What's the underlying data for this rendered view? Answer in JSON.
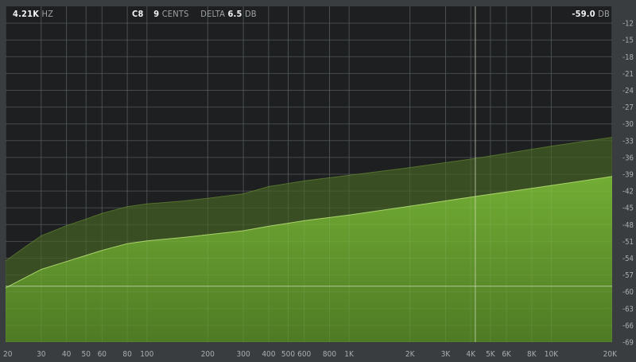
{
  "readout": {
    "frequency": {
      "value": "4.21K",
      "unit": "HZ"
    },
    "note": "C8",
    "cents": {
      "value": "9",
      "unit": "CENTS"
    },
    "delta": {
      "label": "DELTA",
      "value": "6.5",
      "unit": "DB"
    },
    "level": {
      "value": "-59.0",
      "unit": "DB"
    }
  },
  "cursor": {
    "frequency_hz": 4210,
    "level_db": -59.0
  },
  "chart_data": {
    "type": "area",
    "x_scale": "log",
    "xlim": [
      20,
      20000
    ],
    "ylim": [
      -69,
      -9
    ],
    "x_ticks": [
      {
        "label": "20",
        "hz": 20
      },
      {
        "label": "30",
        "hz": 30
      },
      {
        "label": "40",
        "hz": 40
      },
      {
        "label": "50",
        "hz": 50
      },
      {
        "label": "60",
        "hz": 60
      },
      {
        "label": "80",
        "hz": 80
      },
      {
        "label": "100",
        "hz": 100
      },
      {
        "label": "200",
        "hz": 200
      },
      {
        "label": "300",
        "hz": 300
      },
      {
        "label": "400",
        "hz": 400
      },
      {
        "label": "500",
        "hz": 500
      },
      {
        "label": "600",
        "hz": 600
      },
      {
        "label": "800",
        "hz": 800
      },
      {
        "label": "1K",
        "hz": 1000
      },
      {
        "label": "2K",
        "hz": 2000
      },
      {
        "label": "3K",
        "hz": 3000
      },
      {
        "label": "4K",
        "hz": 4000
      },
      {
        "label": "5K",
        "hz": 5000
      },
      {
        "label": "6K",
        "hz": 6000
      },
      {
        "label": "8K",
        "hz": 8000
      },
      {
        "label": "10K",
        "hz": 10000
      },
      {
        "label": "20K",
        "hz": 20000
      }
    ],
    "y_ticks": [
      "-12",
      "-15",
      "-18",
      "-21",
      "-24",
      "-27",
      "-30",
      "-33",
      "-36",
      "-39",
      "-42",
      "-45",
      "-48",
      "-51",
      "-54",
      "-57",
      "-60",
      "-63",
      "-66",
      "-69"
    ],
    "y_tick_values": [
      -12,
      -15,
      -18,
      -21,
      -24,
      -27,
      -30,
      -33,
      -36,
      -39,
      -42,
      -45,
      -48,
      -51,
      -54,
      -57,
      -60,
      -63,
      -66,
      -69
    ],
    "series": [
      {
        "x": [
          20,
          25,
          30,
          40,
          50,
          60,
          80,
          100,
          150,
          200,
          300,
          400,
          600,
          1000,
          2000,
          4000,
          10000,
          20000
        ],
        "y": [
          -54.5,
          -52,
          -50,
          -48.2,
          -47,
          -46,
          -44.8,
          -44.3,
          -43.8,
          -43.3,
          -42.5,
          -41.2,
          -40.2,
          -39.2,
          -37.8,
          -36.3,
          -34,
          -32.4
        ]
      },
      {
        "x": [
          20,
          25,
          30,
          40,
          50,
          60,
          80,
          100,
          150,
          200,
          300,
          400,
          600,
          1000,
          2000,
          4000,
          10000,
          20000
        ],
        "y": [
          -59.3,
          -57.5,
          -56,
          -54.6,
          -53.5,
          -52.6,
          -51.4,
          -50.9,
          -50.3,
          -49.8,
          -49.1,
          -48.3,
          -47.3,
          -46.3,
          -44.7,
          -43.1,
          -41,
          -39.4
        ]
      }
    ],
    "colors": {
      "background": "#1d1f20",
      "grid": "#3b4042",
      "spectrum_fill": "#62932c",
      "peak_fill": "#3d5322",
      "crosshair": "#d8e0c8",
      "frame": "#3a3d3f"
    }
  }
}
